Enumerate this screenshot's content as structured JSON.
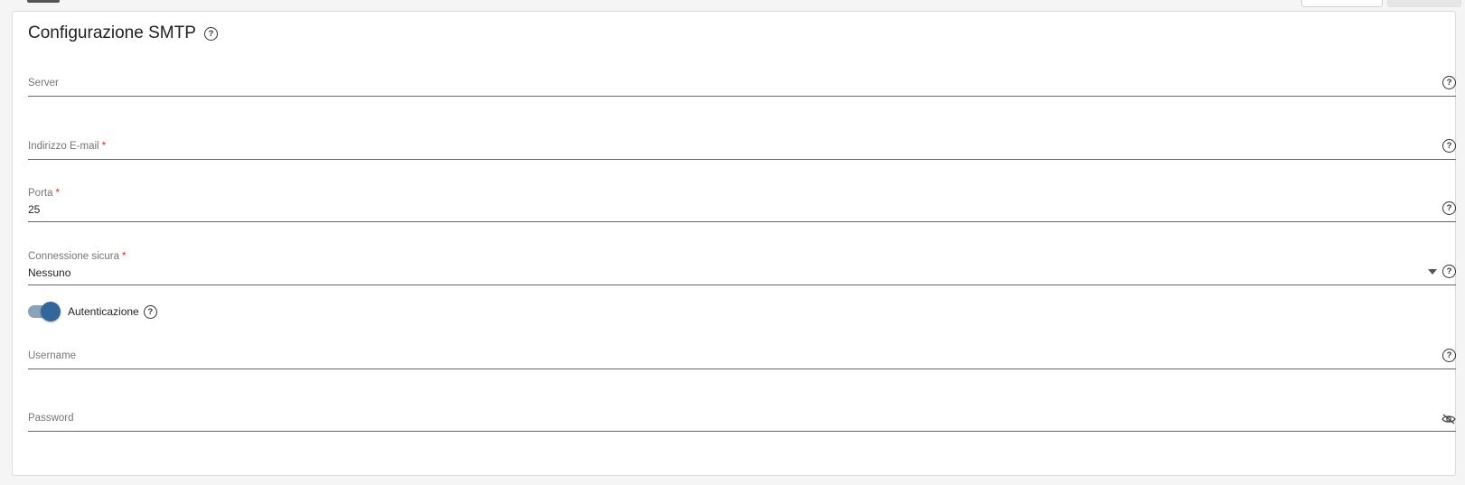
{
  "header": {
    "title": "Configurazione SMTP"
  },
  "fields": {
    "server": {
      "label": "Server",
      "value": "",
      "required": false
    },
    "email": {
      "label": "Indirizzo E-mail",
      "value": "",
      "required": true
    },
    "port": {
      "label": "Porta",
      "value": "25",
      "required": true
    },
    "secure": {
      "label": "Connessione sicura",
      "value": "Nessuno",
      "required": true
    },
    "username": {
      "label": "Username",
      "value": "",
      "required": false
    },
    "password": {
      "label": "Password",
      "value": "",
      "required": false
    }
  },
  "auth": {
    "label": "Autenticazione",
    "enabled": true
  },
  "required_mark": "*",
  "colors": {
    "accent": "#336699",
    "required": "#d32f2f"
  }
}
